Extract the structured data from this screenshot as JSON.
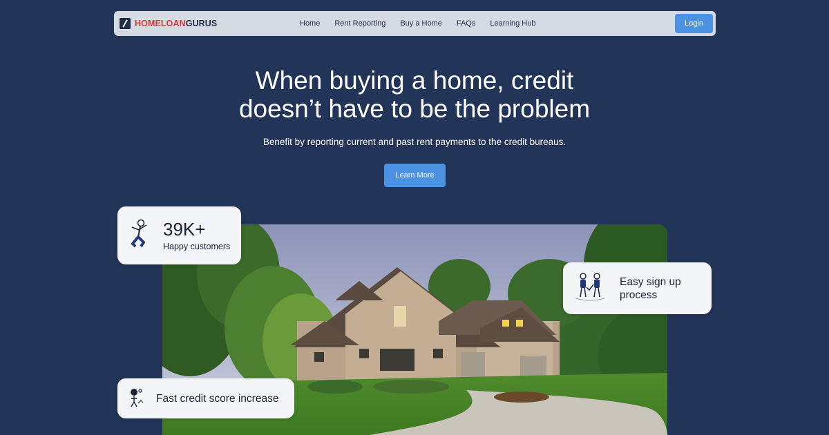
{
  "brand": {
    "part1": "HOMELOAN",
    "part2": "GURUS"
  },
  "nav": {
    "links": [
      "Home",
      "Rent Reporting",
      "Buy a Home",
      "FAQs",
      "Learning Hub"
    ],
    "login_label": "Login"
  },
  "hero": {
    "title_line1": "When buying a home, credit",
    "title_line2": "doesn’t have to be the problem",
    "subtitle": "Benefit by reporting current and past rent payments to the credit bureaus.",
    "cta_label": "Learn More"
  },
  "cards": {
    "customers": {
      "number": "39K+",
      "label": "Happy customers",
      "icon": "jumping-person-icon"
    },
    "signup": {
      "line1": "Easy sign up",
      "line2": "process",
      "icon": "two-people-icon"
    },
    "credit": {
      "text": "Fast credit score increase",
      "icon": "score-gauge-icon"
    }
  },
  "colors": {
    "background": "#223558",
    "accent": "#4b93e2",
    "brand_red": "#d83a3a",
    "brand_navy": "#1f2c4a",
    "nav_bg": "#d6dae3",
    "card_bg": "#f4f5f8"
  }
}
